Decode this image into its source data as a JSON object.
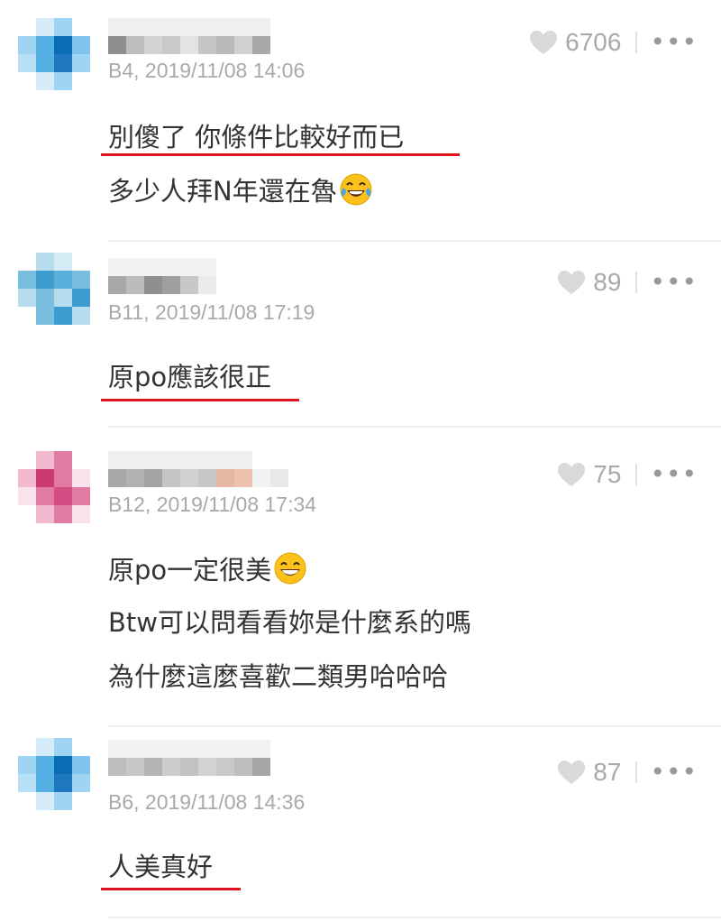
{
  "comments": [
    {
      "floor_time": "B4, 2019/11/08 14:06",
      "likes": "6706",
      "more_label": "•••",
      "lines": [
        "別傻了 你條件比較好而已",
        "多少人拜N年還在魯"
      ],
      "emoji": "face-with-tears-of-joy",
      "avatar_palette": [
        "#0a6cb5",
        "#55b0e3",
        "#9fd4f3",
        "#d5ecfa"
      ]
    },
    {
      "floor_time": "B11, 2019/11/08 17:19",
      "likes": "89",
      "more_label": "•••",
      "lines": [
        "原po應該很正"
      ],
      "avatar_palette": [
        "#3c9ccf",
        "#7bbfe0",
        "#b7dcee"
      ]
    },
    {
      "floor_time": "B12, 2019/11/08 17:34",
      "likes": "75",
      "more_label": "•••",
      "lines": [
        "原po一定很美",
        "Btw可以問看看妳是什麼系的嗎",
        "為什麼這麼喜歡二類男哈哈哈"
      ],
      "emoji": "grinning-face-with-smiling-eyes",
      "avatar_palette": [
        "#c93a72",
        "#e17ba3",
        "#f3b9cf",
        "#fbe3ec"
      ]
    },
    {
      "floor_time": "B6, 2019/11/08 14:36",
      "likes": "87",
      "more_label": "•••",
      "lines": [
        "人美真好"
      ],
      "avatar_palette": [
        "#0a6cb5",
        "#55b0e3",
        "#9fd4f3",
        "#d5ecfa"
      ]
    }
  ],
  "colors": {
    "underline": "#e0141e",
    "meta_text": "#a9a9a9",
    "body_text": "#333333",
    "heart": "#d9d9d9"
  }
}
